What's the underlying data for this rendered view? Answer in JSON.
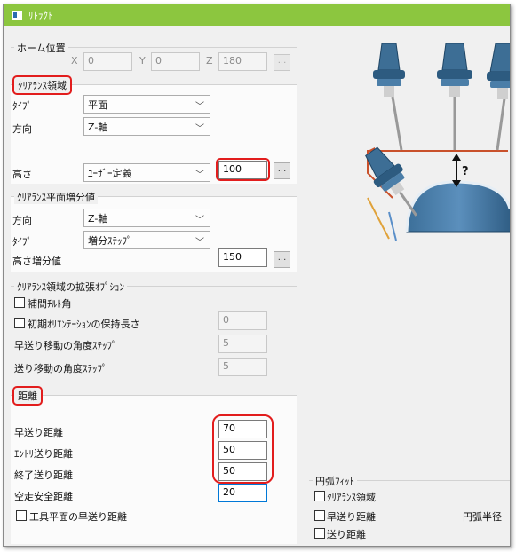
{
  "window": {
    "title": "ﾘﾄﾗｸﾄ"
  },
  "home": {
    "title": "ホーム位置",
    "x_label": "X",
    "x_value": "0",
    "y_label": "Y",
    "y_value": "0",
    "z_label": "Z",
    "z_value": "180",
    "button": "..."
  },
  "clearance": {
    "title": "ｸﾘｱﾗﾝｽ領域",
    "type_label": "ﾀｲﾌﾟ",
    "type_value": "平面",
    "dir_label": "方向",
    "dir_value": "Z-軸",
    "height_label": "高さ",
    "height_mode": "ﾕｰｻﾞｰ定義",
    "height_value": "100",
    "button": "..."
  },
  "increment": {
    "title": "ｸﾘｱﾗﾝｽ平面増分値",
    "dir_label": "方向",
    "dir_value": "Z-軸",
    "type_label": "ﾀｲﾌﾟ",
    "type_value": "増分ｽﾃｯﾌﾟ",
    "height_label": "高さ増分値",
    "height_value": "150",
    "button": "..."
  },
  "extended": {
    "title": "ｸﾘｱﾗﾝｽ領域の拡張ｵﾌﾟｼｮﾝ",
    "tilt_label": "補間ﾁﾙﾄ角",
    "keep_label": "初期ｵﾘｴﾝﾃｰｼｮﾝの保持長さ",
    "keep_value": "0",
    "rapid_step_label": "早送り移動の角度ｽﾃｯﾌﾟ",
    "rapid_step_value": "5",
    "feed_step_label": "送り移動の角度ｽﾃｯﾌﾟ",
    "feed_step_value": "5"
  },
  "distance": {
    "title": "距離",
    "rapid_label": "早送り距離",
    "rapid_value": "70",
    "entry_label": "ｴﾝﾄﾘ送り距離",
    "entry_value": "50",
    "exit_label": "終了送り距離",
    "exit_value": "50",
    "air_label": "空走安全距離",
    "air_value": "20",
    "tool_plane_label": "工具平面の早送り距離"
  },
  "arc_fit": {
    "title": "円弧ﾌｨｯﾄ",
    "clearance_label": "ｸﾘｱﾗﾝｽ領域",
    "rapid_label": "早送り距離",
    "radius_label": "円弧半径",
    "feed_label": "送り距離"
  },
  "illustration": {
    "question": "?"
  }
}
